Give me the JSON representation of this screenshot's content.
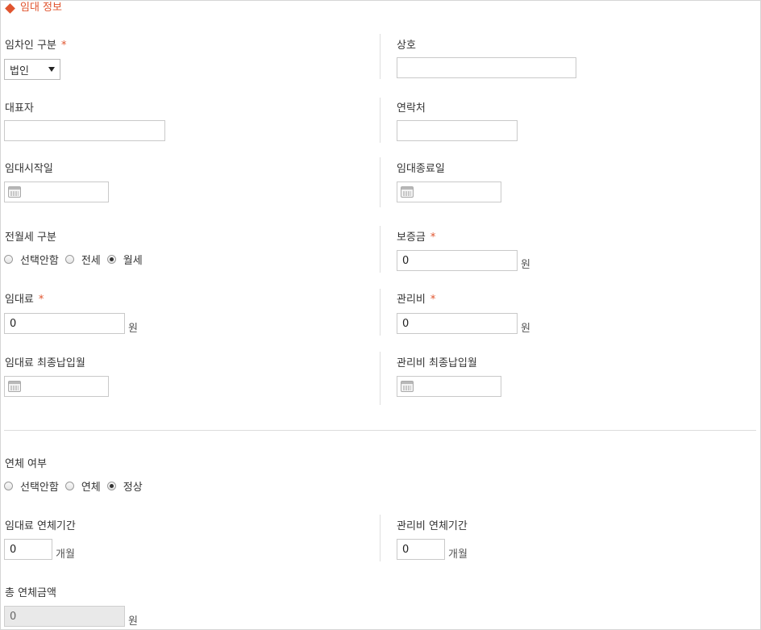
{
  "section": {
    "title": "임대 정보"
  },
  "units": {
    "won": "원",
    "months": "개월"
  },
  "tenant_type": {
    "label": "임차인 구분",
    "required_mark": "*",
    "selected": "법인"
  },
  "business_name": {
    "label": "상호",
    "value": ""
  },
  "representative": {
    "label": "대표자",
    "value": ""
  },
  "contact": {
    "label": "연락처",
    "value": ""
  },
  "lease_start": {
    "label": "임대시작일",
    "value": ""
  },
  "lease_end": {
    "label": "임대종료일",
    "value": ""
  },
  "rent_type": {
    "label": "전월세 구분",
    "options": [
      "선택안함",
      "전세",
      "월세"
    ],
    "selected": "월세"
  },
  "deposit": {
    "label": "보증금",
    "required_mark": "*",
    "value": "0"
  },
  "rent": {
    "label": "임대료",
    "required_mark": "*",
    "value": "0"
  },
  "mgmt_fee": {
    "label": "관리비",
    "required_mark": "*",
    "value": "0"
  },
  "rent_last_paid": {
    "label": "임대료 최종납입월",
    "value": ""
  },
  "mgmt_last_paid": {
    "label": "관리비 최종납입월",
    "value": ""
  },
  "overdue": {
    "label": "연체 여부",
    "options": [
      "선택안함",
      "연체",
      "정상"
    ],
    "selected": "정상"
  },
  "rent_overdue_period": {
    "label": "임대료 연체기간",
    "value": "0"
  },
  "mgmt_overdue_period": {
    "label": "관리비 연체기간",
    "value": "0"
  },
  "total_overdue": {
    "label": "총 연체금액",
    "value": "0"
  },
  "colors": {
    "accent": "#e0542e",
    "border": "#c9c9c9"
  }
}
